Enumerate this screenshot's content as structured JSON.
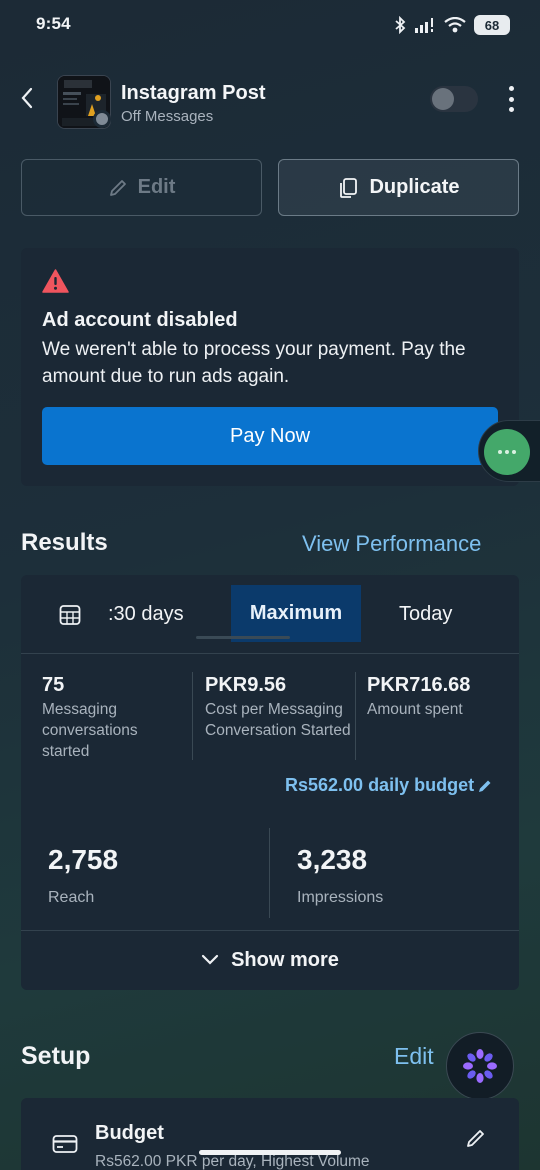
{
  "status_bar": {
    "time": "9:54",
    "battery": "68"
  },
  "header": {
    "title": "Instagram Post",
    "status": "Off",
    "objective": "Messages"
  },
  "actions": {
    "edit_label": "Edit",
    "duplicate_label": "Duplicate"
  },
  "alert": {
    "title": "Ad account disabled",
    "message": "We weren't able to process your payment. Pay the amount due to run ads again.",
    "button": "Pay Now"
  },
  "results": {
    "heading": "Results",
    "link": "View Performance",
    "periods": {
      "partial": ":30 days",
      "selected": "Maximum",
      "other": "Today"
    },
    "metrics": [
      {
        "value": "75",
        "label": "Messaging conversations started"
      },
      {
        "value": "PKR9.56",
        "label": "Cost per Messaging Conversation Started"
      },
      {
        "value": "PKR716.68",
        "label": "Amount spent"
      }
    ],
    "daily_budget": "Rs562.00 daily budget",
    "reach": {
      "value": "2,758",
      "label": "Reach"
    },
    "impressions": {
      "value": "3,238",
      "label": "Impressions"
    },
    "show_more": "Show more"
  },
  "setup": {
    "heading": "Setup",
    "edit": "Edit",
    "budget": {
      "title": "Budget",
      "detail": "Rs562.00 PKR per day, Highest Volume"
    }
  },
  "colors": {
    "accent_link": "#7ec0ef",
    "primary_button": "#0a74cf",
    "warning": "#f0555e",
    "selected_period": "#0b3a6b"
  }
}
